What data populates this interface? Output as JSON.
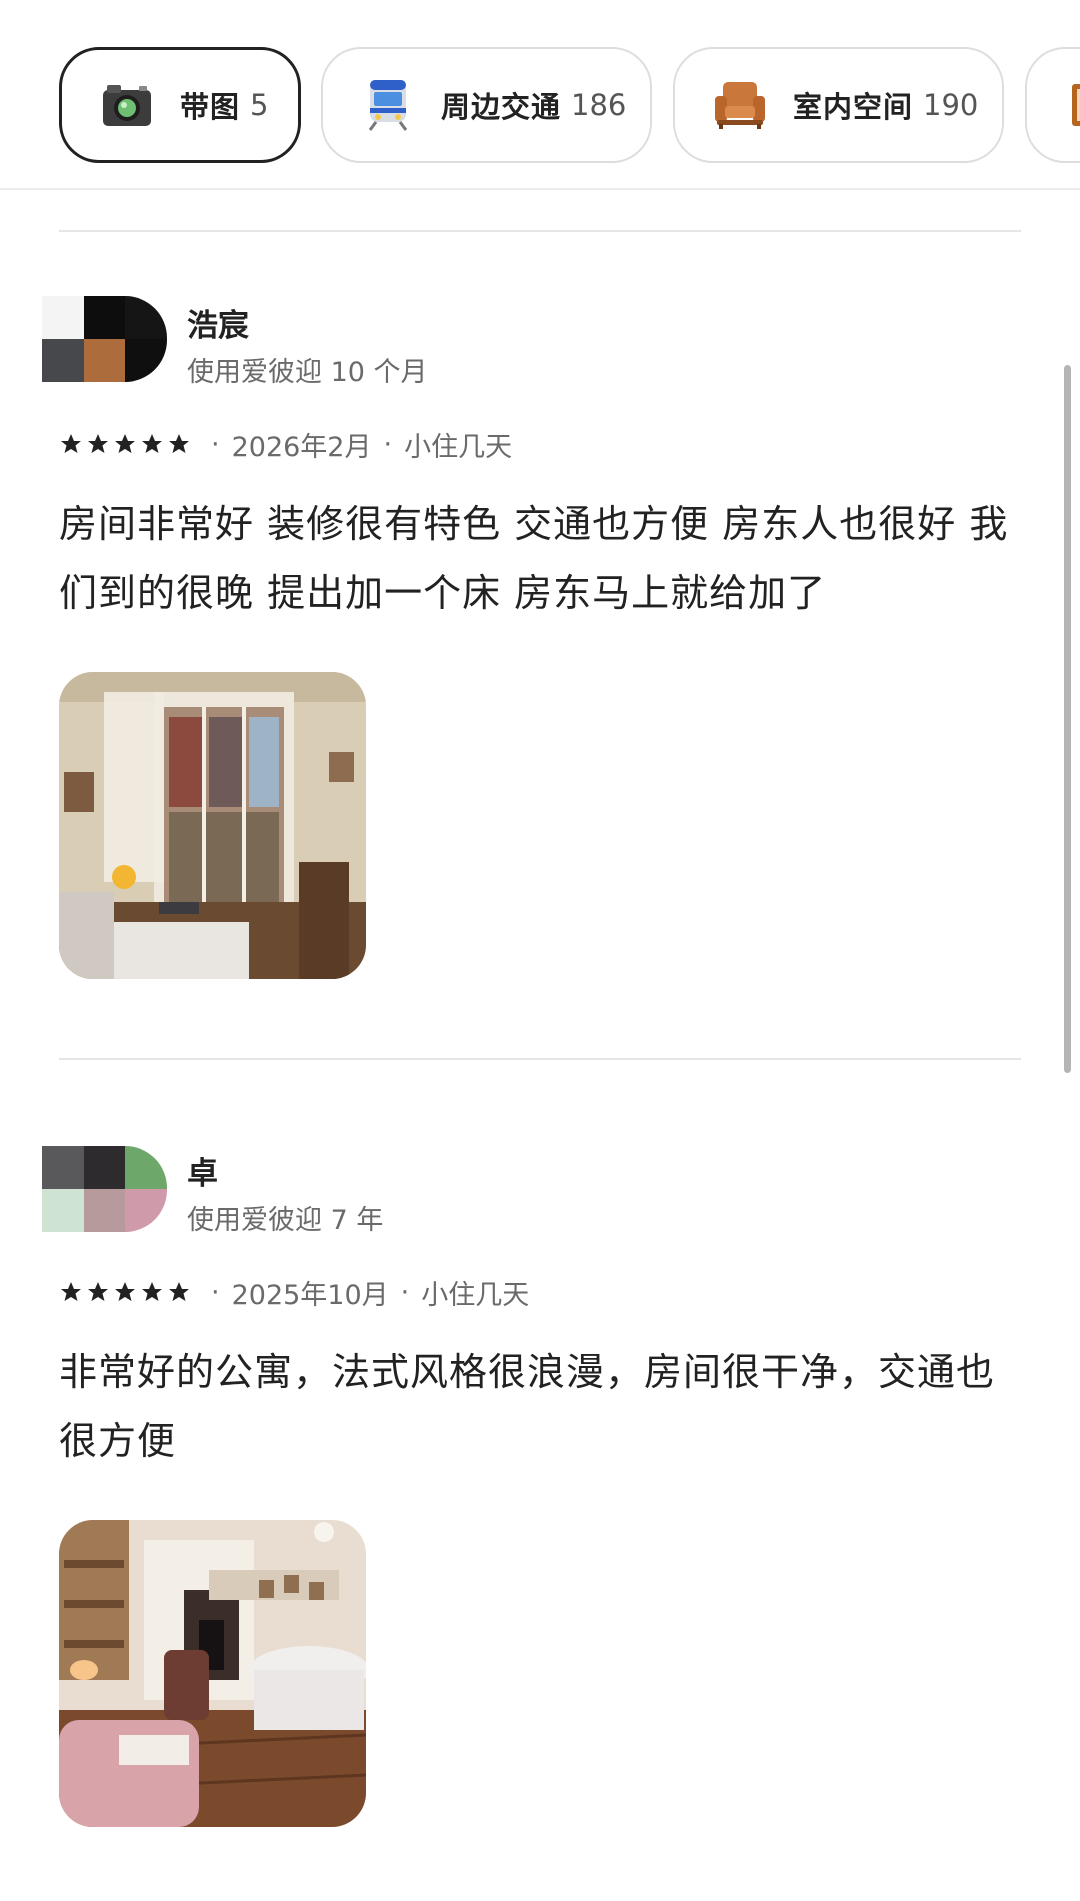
{
  "filters": [
    {
      "label": "带图",
      "count": "5",
      "icon": "camera-icon",
      "active": true
    },
    {
      "label": "周边交通",
      "count": "186",
      "icon": "train-icon",
      "active": false
    },
    {
      "label": "室内空间",
      "count": "190",
      "icon": "armchair-icon",
      "active": false
    }
  ],
  "reviews": [
    {
      "name": "浩宸",
      "tenure": "使用爱彼迎 10 个月",
      "rating": 5,
      "date": "2026年2月",
      "stay": "小住几天",
      "text_line1": "房间非常好 装修很有特色 交通也方便 房东人也很好 我",
      "text_line2": "们到的很晚 提出加一个床 房东马上就给加了"
    },
    {
      "name": "卓",
      "tenure": "使用爱彼迎 7 年",
      "rating": 5,
      "date": "2025年10月",
      "stay": "小住几天",
      "text_line1": "非常好的公寓，法式风格很浪漫，房间很干净，交通也",
      "text_line2": "很方便"
    }
  ],
  "separator": "·",
  "colors": {
    "text_primary": "#222222",
    "text_secondary": "#6a6a6a",
    "chip_border": "#dddddd",
    "chip_active_border": "#222222",
    "divider": "#e6e6e6"
  }
}
